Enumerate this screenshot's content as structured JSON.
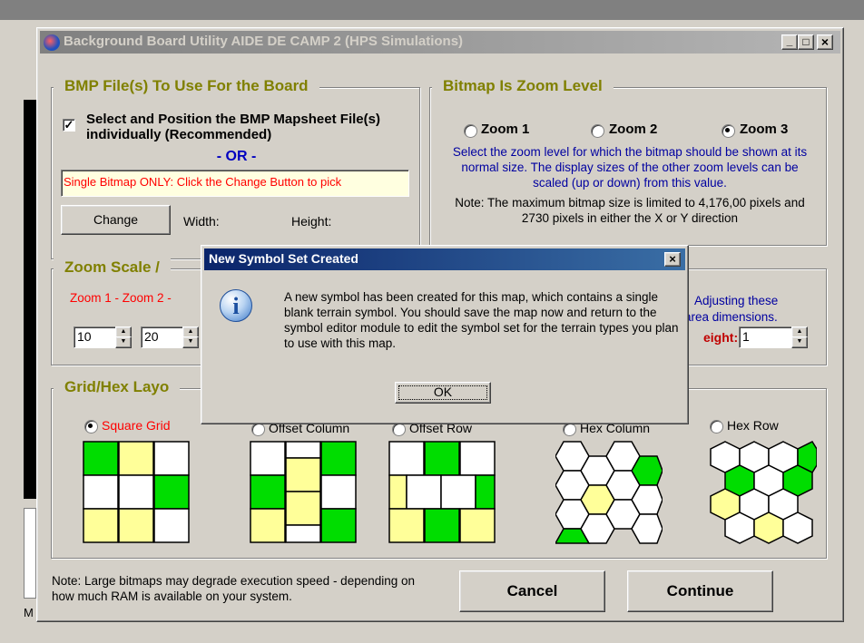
{
  "window": {
    "title": "Background Board Utility  AIDE DE CAMP 2  (HPS Simulations)",
    "controls": [
      "_",
      "□",
      "×"
    ]
  },
  "bmp_group": {
    "title": "BMP File(s) To Use For the  Board",
    "checkbox_label": "Select and Position the BMP Mapsheet File(s) individually (Recommended)",
    "checked": true,
    "or_text": "- OR -",
    "single_field_text": "Single Bitmap ONLY: Click the Change Button to pick",
    "change_button": "Change",
    "width_label": "Width:",
    "height_label": "Height:"
  },
  "zoom_group": {
    "title": "Bitmap Is Zoom Level",
    "options": [
      "Zoom 1",
      "Zoom 2",
      "Zoom 3"
    ],
    "selected": "Zoom 3",
    "description": "Select the zoom level for which the bitmap should be shown at its normal size.  The display sizes of the other zoom levels can be scaled (up or down) from this value.",
    "note": "Note:  The maximum bitmap size is limited to 4,176,00 pixels and 2730 pixels in either the X or Y direction"
  },
  "scale_group": {
    "title": "Zoom Scale /",
    "labels_text": "Zoom 1 - Zoom 2 -",
    "spin1": "10",
    "spin2": "20",
    "right_text_1": "Adjusting these",
    "right_text_2": "area dimensions.",
    "height_label": "eight:",
    "height_value": "1"
  },
  "grid_group": {
    "title": "Grid/Hex Layo",
    "options": [
      "Square Grid",
      "Offset Column",
      "Offset Row",
      "Hex Column",
      "Hex Row"
    ],
    "selected": "Square Grid"
  },
  "footer": {
    "note": "Note:  Large bitmaps may degrade execution speed - depending on how much RAM is available on your system.",
    "cancel": "Cancel",
    "continue": "Continue"
  },
  "dialog": {
    "title": "New Symbol Set Created",
    "close": "×",
    "message": "A new symbol has been created for this map, which contains a single blank terrain symbol.  You should save the map now and return to the symbol editor module to edit the symbol set for the terrain types you plan to use with this map.",
    "ok": "OK",
    "icon": "info-icon"
  },
  "background_app": {
    "status_letter": "M"
  },
  "colors": {
    "title_active": "#0a246a",
    "title_inactive": "#808080",
    "group_title": "#808000",
    "blue_text": "#0000a0",
    "red_text": "#ff0000",
    "green": "#00dd00",
    "yellow": "#ffff99"
  }
}
